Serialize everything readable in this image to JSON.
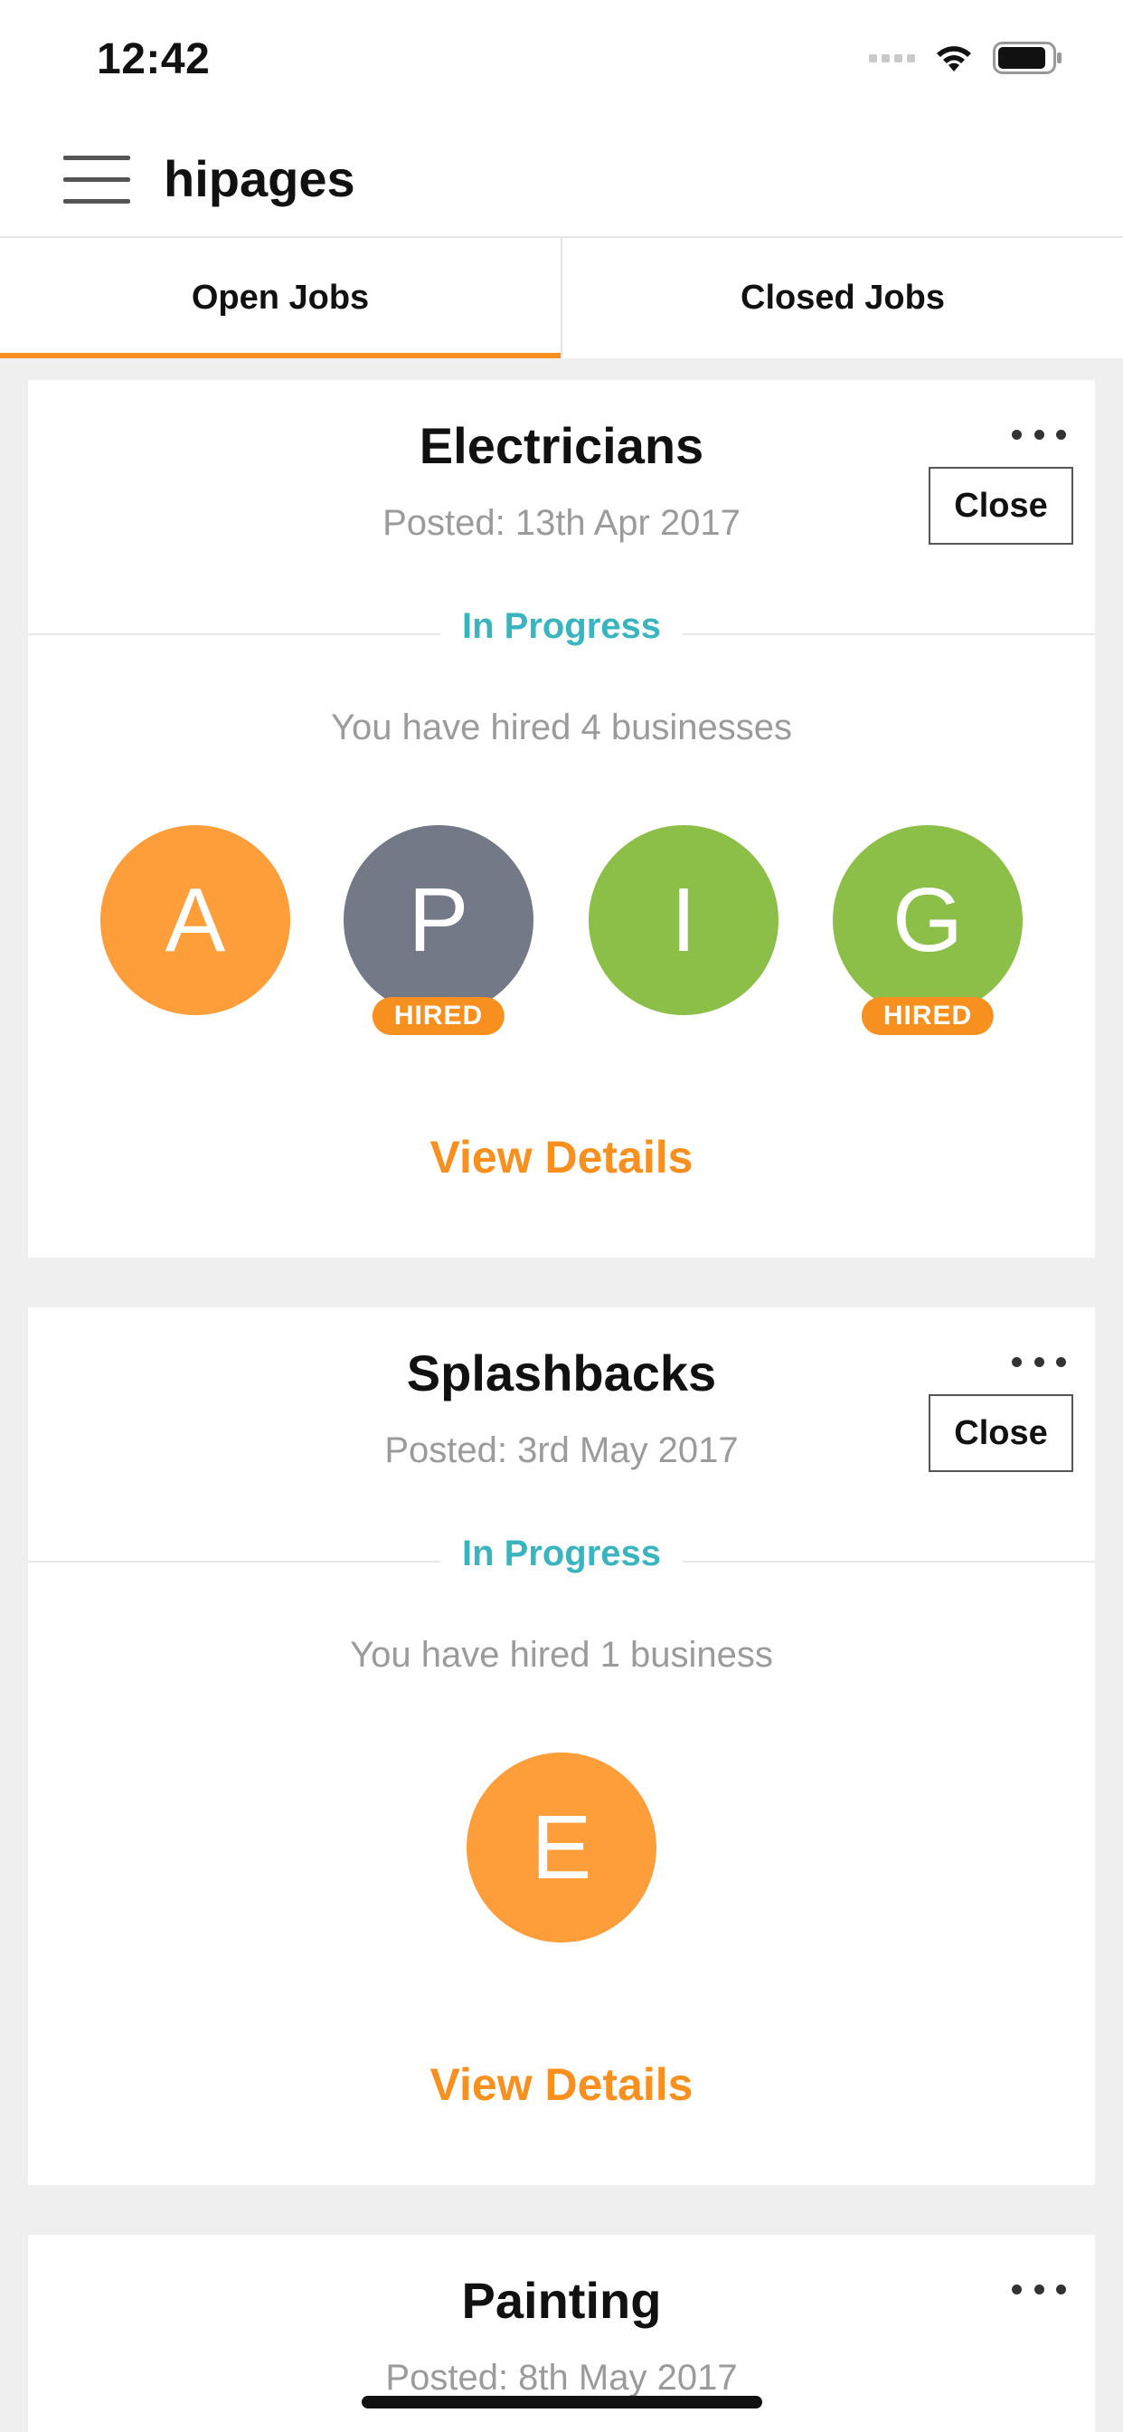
{
  "status_bar": {
    "time": "12:42"
  },
  "header": {
    "title": "hipages"
  },
  "tabs": [
    {
      "label": "Open Jobs",
      "active": true
    },
    {
      "label": "Closed Jobs",
      "active": false
    }
  ],
  "colors": {
    "accent": "#f7901e",
    "status": "#3ab5bf",
    "avatar_orange": "#fe9e3a",
    "avatar_gray": "#737986",
    "avatar_green": "#8cbf48"
  },
  "jobs": [
    {
      "title": "Electricians",
      "posted": "Posted: 13th Apr 2017",
      "close_label": "Close",
      "status": "In Progress",
      "hired_text": "You have hired 4 businesses",
      "avatars": [
        {
          "letter": "A",
          "color": "#fe9e3a",
          "hired": false
        },
        {
          "letter": "P",
          "color": "#737986",
          "hired": true,
          "badge": "HIRED"
        },
        {
          "letter": "I",
          "color": "#8cbf48",
          "hired": false
        },
        {
          "letter": "G",
          "color": "#8cbf48",
          "hired": true,
          "badge": "HIRED"
        }
      ],
      "view_details": "View Details"
    },
    {
      "title": "Splashbacks",
      "posted": "Posted: 3rd May 2017",
      "close_label": "Close",
      "status": "In Progress",
      "hired_text": "You have hired 1 business",
      "avatars": [
        {
          "letter": "E",
          "color": "#fe9e3a",
          "hired": false
        }
      ],
      "view_details": "View Details"
    },
    {
      "title": "Painting",
      "posted": "Posted: 8th May 2017"
    }
  ]
}
